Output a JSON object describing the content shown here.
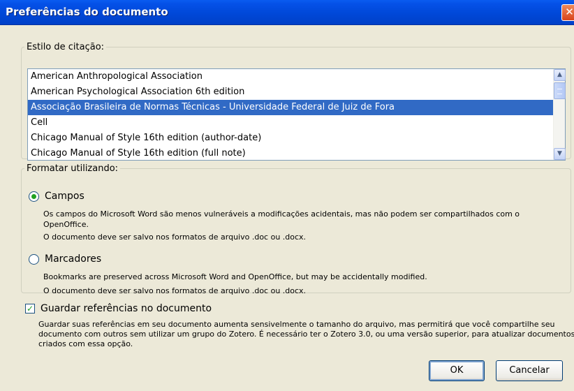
{
  "window": {
    "title": "Preferências do documento",
    "close_label": "✕"
  },
  "citation_style": {
    "legend": "Estilo de citação:",
    "items": [
      {
        "label": "American Anthropological Association",
        "selected": false
      },
      {
        "label": "American Psychological Association 6th edition",
        "selected": false
      },
      {
        "label": "Associação Brasileira de Normas Técnicas - Universidade Federal de Juiz de Fora",
        "selected": true
      },
      {
        "label": "Cell",
        "selected": false
      },
      {
        "label": "Chicago Manual of Style 16th edition (author-date)",
        "selected": false
      },
      {
        "label": "Chicago Manual of Style 16th edition (full note)",
        "selected": false
      }
    ]
  },
  "format": {
    "legend": "Formatar utilizando:",
    "fields_label": "Campos",
    "fields_checked": true,
    "fields_desc1": "Os campos do Microsoft Word são menos vulneráveis a modificações acidentais, mas não podem ser compartilhados com o OpenOffice.",
    "fields_desc2": "O documento deve ser salvo nos formatos de arquivo .doc ou .docx.",
    "bookmarks_label": "Marcadores",
    "bookmarks_checked": false,
    "bookmarks_desc1": "Bookmarks are preserved across Microsoft Word and OpenOffice, but may be accidentally modified.",
    "bookmarks_desc2": "O documento deve ser salvo nos formatos de arquivo .doc ou .docx."
  },
  "store_refs": {
    "label": "Guardar referências no documento",
    "checked": true,
    "desc": "Guardar suas referências em seu documento aumenta sensivelmente o tamanho do arquivo, mas permitirá que você compartilhe seu documento com outros sem utilizar um grupo do Zotero. É necessário ter o Zotero 3.0, ou uma versão superior, para atualizar documentos criados com essa opção."
  },
  "buttons": {
    "ok": "OK",
    "cancel": "Cancelar"
  },
  "colors": {
    "titlebar": "#0048d8",
    "selection": "#316ac5",
    "dialog_bg": "#ece9d8",
    "radio_check": "#21a121"
  }
}
